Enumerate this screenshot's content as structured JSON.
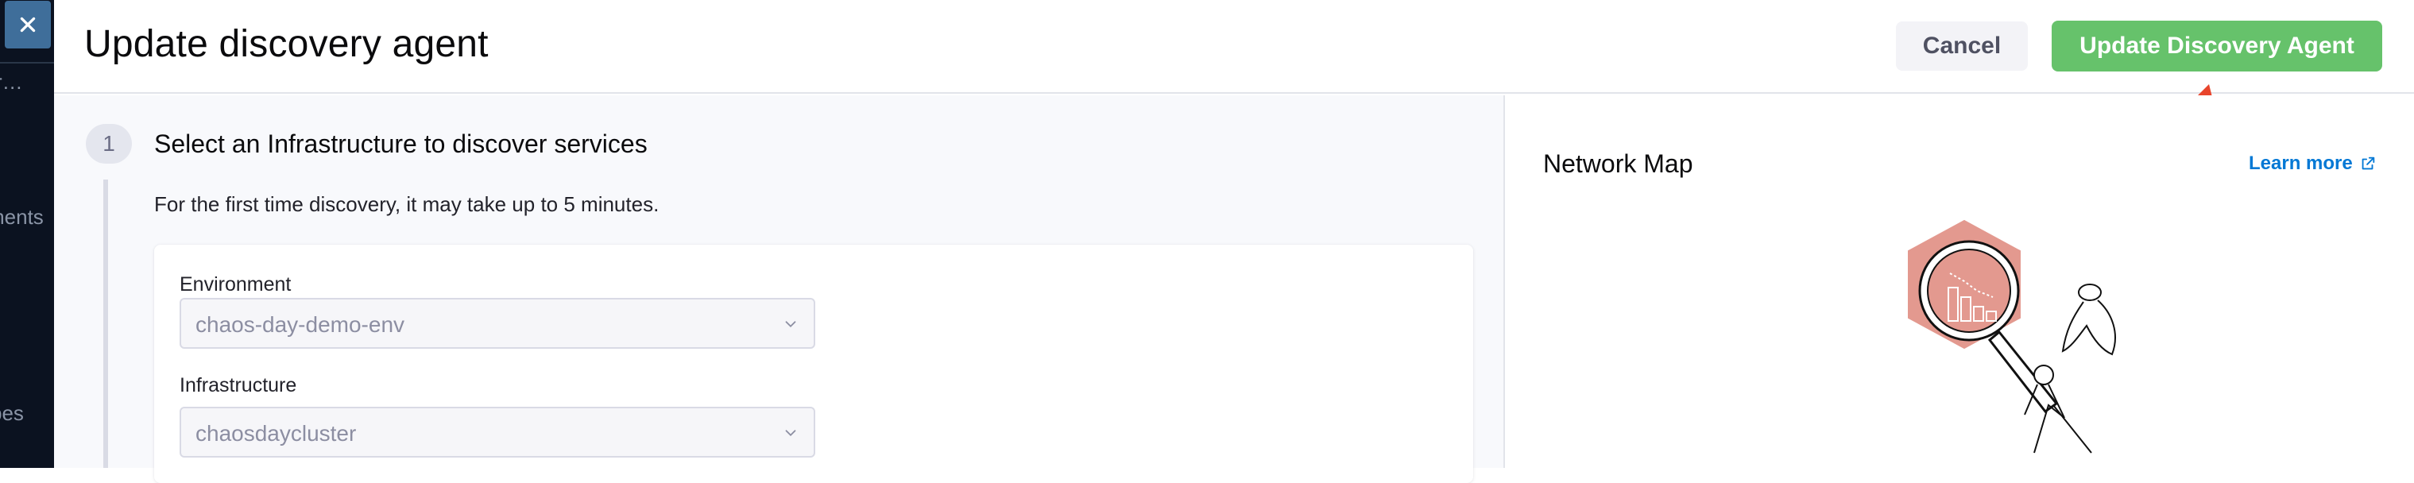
{
  "background_page": {
    "fragment_1": "r…",
    "fragment_2": "ments",
    "fragment_3": "pes"
  },
  "drawer": {
    "title": "Update discovery agent",
    "cancel_label": "Cancel",
    "submit_label": "Update Discovery Agent"
  },
  "step": {
    "number": "1",
    "title": "Select an Infrastructure to discover services",
    "description": "For the first time discovery, it may take up to 5 minutes."
  },
  "form": {
    "environment_label": "Environment",
    "environment_value": "chaos-day-demo-env",
    "infrastructure_label": "Infrastructure",
    "infrastructure_value": "chaosdaycluster"
  },
  "network_map": {
    "title": "Network Map",
    "learn_more": "Learn more"
  },
  "colors": {
    "primary_button": "#66c26b",
    "link": "#0278d5",
    "annotation_arrow": "#e8452c",
    "illustration_accent": "#e3998f"
  },
  "icons": [
    "close-icon",
    "chevron-down-icon",
    "external-link-icon",
    "arrow-annotation"
  ]
}
